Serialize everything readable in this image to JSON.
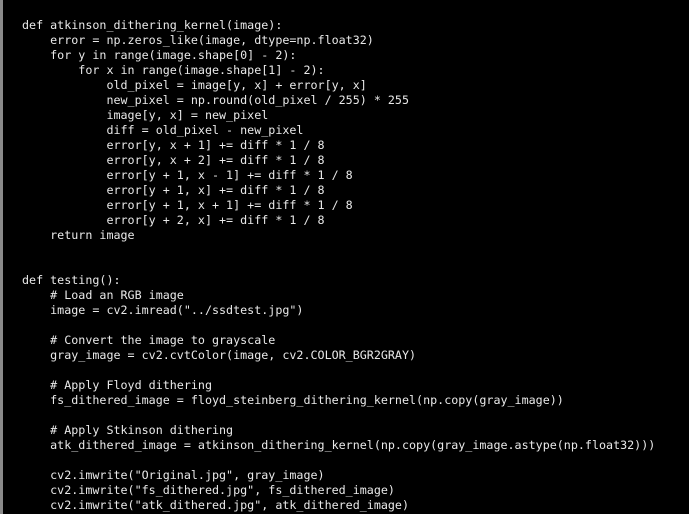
{
  "editor": {
    "background_color": "#000000",
    "text_color": "#e9e9e9",
    "border_color": "#8a8a8a",
    "language": "python",
    "syntax_highlighting": false
  },
  "code": {
    "lines": [
      "def atkinson_dithering_kernel(image):",
      "    error = np.zeros_like(image, dtype=np.float32)",
      "    for y in range(image.shape[0] - 2):",
      "        for x in range(image.shape[1] - 2):",
      "            old_pixel = image[y, x] + error[y, x]",
      "            new_pixel = np.round(old_pixel / 255) * 255",
      "            image[y, x] = new_pixel",
      "            diff = old_pixel - new_pixel",
      "            error[y, x + 1] += diff * 1 / 8",
      "            error[y, x + 2] += diff * 1 / 8",
      "            error[y + 1, x - 1] += diff * 1 / 8",
      "            error[y + 1, x] += diff * 1 / 8",
      "            error[y + 1, x + 1] += diff * 1 / 8",
      "            error[y + 2, x] += diff * 1 / 8",
      "    return image",
      "",
      "",
      "def testing():",
      "    # Load an RGB image",
      "    image = cv2.imread(\"../ssdtest.jpg\")",
      "",
      "    # Convert the image to grayscale",
      "    gray_image = cv2.cvtColor(image, cv2.COLOR_BGR2GRAY)",
      "",
      "    # Apply Floyd dithering",
      "    fs_dithered_image = floyd_steinberg_dithering_kernel(np.copy(gray_image))",
      "",
      "    # Apply Stkinson dithering",
      "    atk_dithered_image = atkinson_dithering_kernel(np.copy(gray_image.astype(np.float32)))",
      "",
      "    cv2.imwrite(\"Original.jpg\", gray_image)",
      "    cv2.imwrite(\"fs_dithered.jpg\", fs_dithered_image)",
      "    cv2.imwrite(\"atk_dithered.jpg\", atk_dithered_image)"
    ]
  }
}
